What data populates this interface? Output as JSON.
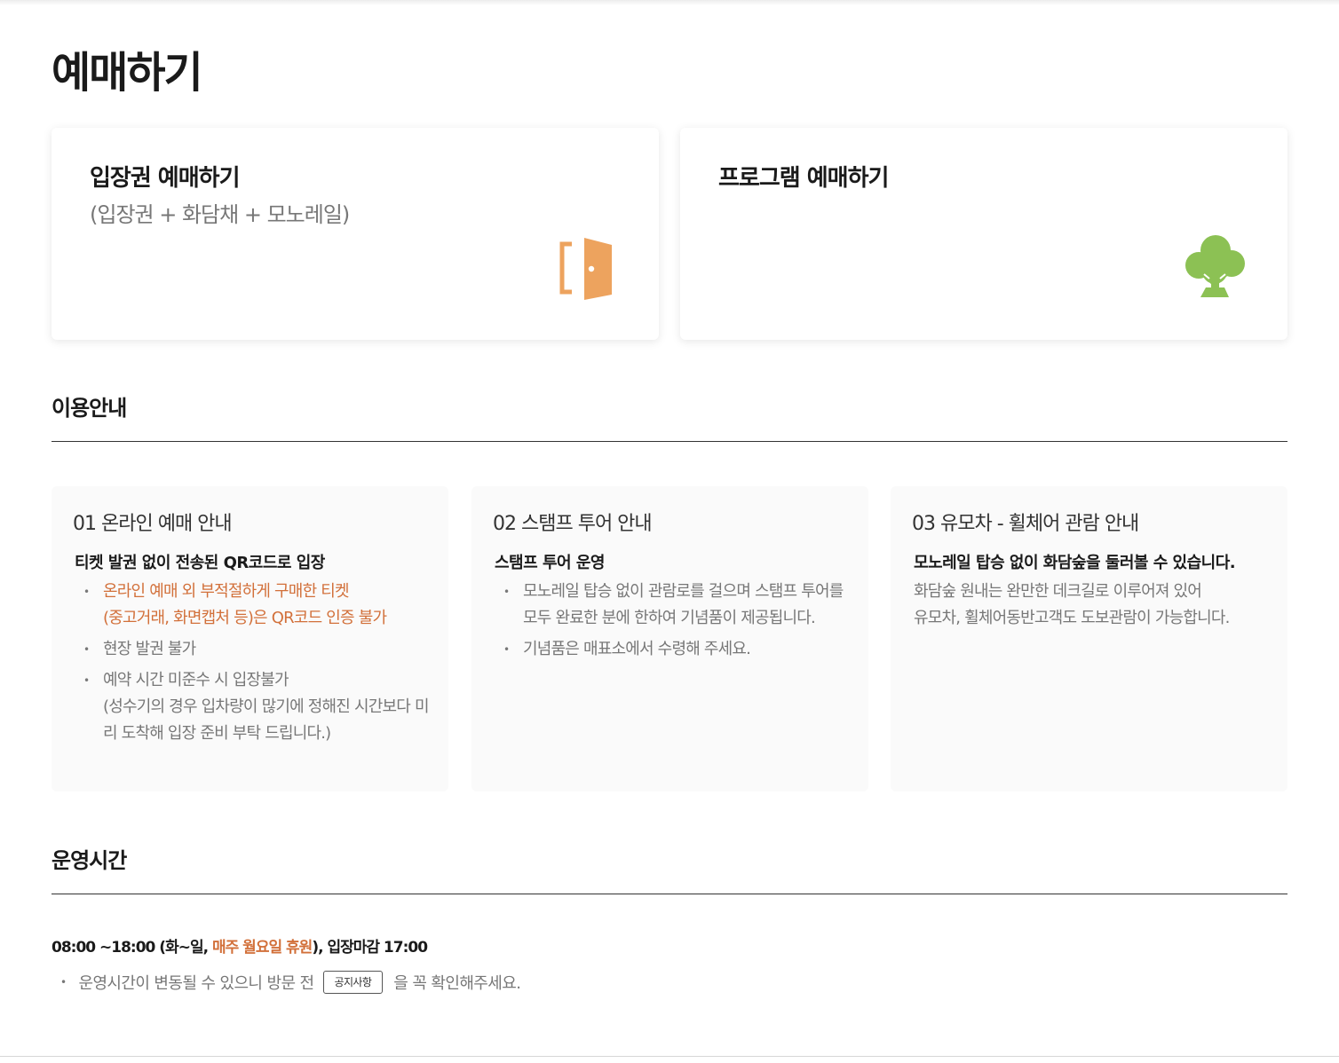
{
  "page": {
    "title": "예매하기"
  },
  "booking": {
    "admission": {
      "title": "입장권 예매하기",
      "subtitle": "(입장권 + 화담채 + 모노레일)",
      "icon": "door-icon",
      "icon_color": "#eda35e"
    },
    "program": {
      "title": "프로그램 예매하기",
      "icon": "tree-icon",
      "icon_color": "#8cc154"
    }
  },
  "guide": {
    "title": "이용안내",
    "cards": [
      {
        "heading": "01 온라인 예매 안내",
        "lead": "티켓 발권 없이 전송된 QR코드로 입장",
        "items": [
          {
            "line1": "온라인 예매 외 부적절하게 구매한 티켓",
            "line2": "(중고거래, 화면캡처 등)은 QR코드 인증 불가"
          },
          {
            "text": "현장 발권 불가"
          },
          {
            "line1": "예약 시간 미준수 시 입장불가",
            "line2": "(성수기의 경우 입차량이 많기에 정해진 시간보다 미리 도착해 입장 준비 부탁 드립니다.)"
          }
        ]
      },
      {
        "heading": "02 스탬프 투어 안내",
        "lead": "스탬프 투어 운영",
        "items": [
          {
            "text": "모노레일 탑승 없이 관람로를 걸으며 스탬프 투어를 모두 완료한 분에 한하여 기념품이 제공됩니다."
          },
          {
            "text": "기념품은 매표소에서 수령해 주세요."
          }
        ]
      },
      {
        "heading": "03 유모차 - 휠체어 관람 안내",
        "lead": "모노레일 탑승 없이 화담숲을 둘러볼 수 있습니다.",
        "line1": "화담숲 원내는 완만한 데크길로 이루어져 있어",
        "line2": "유모차, 휠체어동반고객도 도보관람이 가능합니다."
      }
    ]
  },
  "hours": {
    "title": "운영시간",
    "time_prefix": "08:00 ~18:00 (화~일, ",
    "closed": "매주 월요일 휴원",
    "time_suffix": "), 입장마감 17:00",
    "notice_before": "운영시간이 변동될 수 있으니 방문 전",
    "notice_button": "공지사항",
    "notice_after": "을 꼭 확인해주세요."
  },
  "colors": {
    "accent": "#d2703a",
    "door": "#eda35e",
    "tree": "#8cc154"
  }
}
